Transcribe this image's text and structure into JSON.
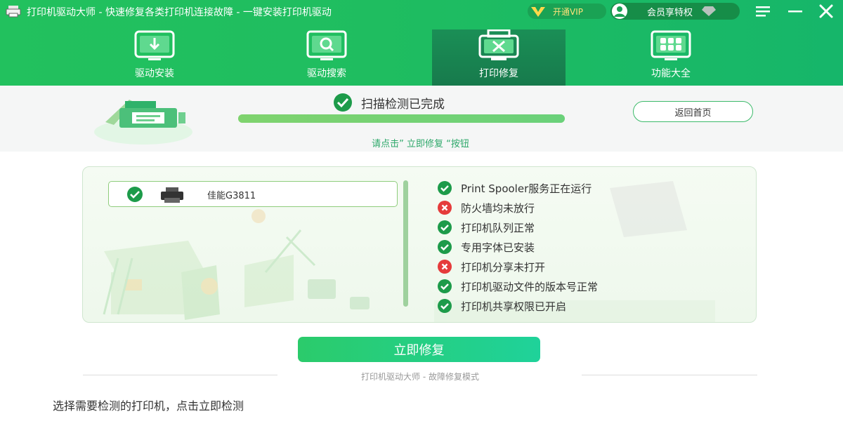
{
  "window": {
    "title": "打印机驱动大师 - 快速修复各类打印机连接故障 - 一键安装打印机驱动",
    "vip_label": "开通VIP",
    "user_label": "会员享特权"
  },
  "tabs": [
    {
      "label": "驱动安装",
      "icon": "driver-install-icon",
      "active": false
    },
    {
      "label": "驱动搜索",
      "icon": "driver-search-icon",
      "active": false
    },
    {
      "label": "打印修复",
      "icon": "printer-repair-icon",
      "active": true
    },
    {
      "label": "功能大全",
      "icon": "all-features-icon",
      "active": false
    }
  ],
  "status": {
    "scan_text": "扫描检测已完成",
    "progress": 1.0,
    "back_label": "返回首页",
    "hint": "请点击” 立即修复 “按钮"
  },
  "printer": {
    "name": "佳能G3811"
  },
  "checks": [
    {
      "text": "Print Spooler服务正在运行",
      "ok": true
    },
    {
      "text": "防火墙均未放行",
      "ok": false
    },
    {
      "text": "打印机队列正常",
      "ok": true
    },
    {
      "text": "专用字体已安装",
      "ok": true
    },
    {
      "text": "打印机分享未打开",
      "ok": false
    },
    {
      "text": "打印机驱动文件的版本号正常",
      "ok": true
    },
    {
      "text": "打印机共享权限已开启",
      "ok": true
    }
  ],
  "repair_label": "立即修复",
  "footer": "打印机驱动大师 - 故障修复模式",
  "bottom_message": "选择需要检测的打印机，点击立即检测",
  "colors": {
    "brand_green": "#22c15e",
    "active_tab": "#177a4c",
    "ok": "#1d9b4a",
    "error": "#e53b3b"
  }
}
